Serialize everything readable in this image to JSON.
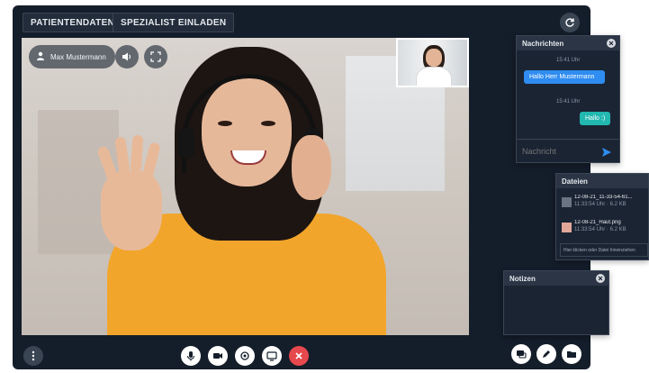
{
  "header": {
    "patient_button": "PATIENTENDATEN",
    "specialist_button": "SPEZIALIST EINLADEN",
    "refresh_icon": "refresh-icon"
  },
  "video": {
    "participant_name": "Max Mustermann",
    "icons": [
      "user-icon",
      "speaker-icon",
      "fullscreen-icon"
    ]
  },
  "controls": {
    "left": "more-vertical-icon",
    "center": [
      "microphone-icon",
      "camera-icon",
      "switch-camera-icon",
      "screen-share-icon",
      "hangup-icon"
    ],
    "right": [
      "chat-icon",
      "pencil-icon",
      "folder-icon"
    ],
    "colors": {
      "hangup": "#e5484d"
    }
  },
  "chat": {
    "title": "Nachrichten",
    "messages": [
      {
        "time": "15:41 Uhr",
        "text": "Hallo Herr Mustermann",
        "side": "left",
        "color": "#2f8cf0"
      },
      {
        "time": "15:41 Uhr",
        "text": "Hallo :)",
        "side": "right",
        "color": "#22b8b0"
      }
    ],
    "input_placeholder": "Nachricht",
    "send_icon": "send-icon"
  },
  "files": {
    "title": "Dateien",
    "items": [
      {
        "name": "12-08-21_11-33-54-61...",
        "meta": "11:33:54 Uhr · 6.2 KB"
      },
      {
        "name": "12-08-21_Haut.png",
        "meta": "11:33:54 Uhr · 6.2 KB"
      }
    ],
    "dropzone": "Hier klicken oder Datei hineinziehen"
  },
  "notes": {
    "title": "Notizen"
  }
}
